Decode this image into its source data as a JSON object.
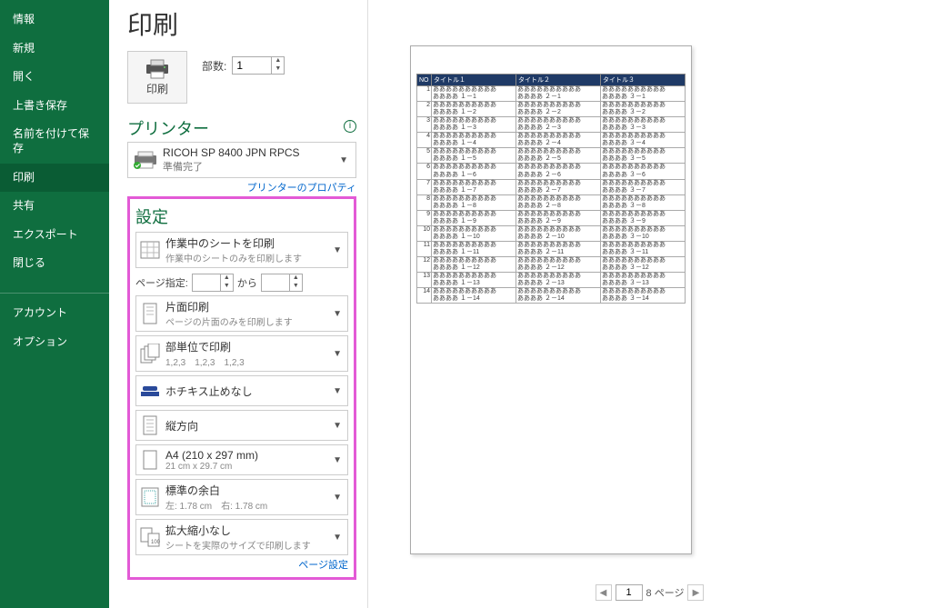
{
  "side": {
    "items": [
      "情報",
      "新規",
      "開く",
      "上書き保存",
      "名前を付けて保存",
      "印刷",
      "共有",
      "エクスポート",
      "閉じる"
    ],
    "lower": [
      "アカウント",
      "オプション"
    ],
    "activeIndex": 5
  },
  "title": "印刷",
  "printBtnLabel": "印刷",
  "copies": {
    "label": "部数:",
    "value": "1"
  },
  "printer": {
    "heading": "プリンター",
    "name": "RICOH SP 8400 JPN RPCS",
    "status": "準備完了",
    "propLink": "プリンターのプロパティ"
  },
  "settings": {
    "heading": "設定",
    "whatToPrint": {
      "line1": "作業中のシートを印刷",
      "line2": "作業中のシートのみを印刷します"
    },
    "pageRangeLabel": "ページ指定:",
    "pageRangeFrom": "",
    "pageRangeMid": "から",
    "pageRangeTo": "",
    "sides": {
      "line1": "片面印刷",
      "line2": "ページの片面のみを印刷します"
    },
    "collate": {
      "line1": "部単位で印刷",
      "line2": "1,2,3　1,2,3　1,2,3"
    },
    "staple": {
      "line1": "ホチキス止めなし"
    },
    "orient": {
      "line1": "縦方向"
    },
    "size": {
      "line1": "A4 (210 x 297 mm)",
      "line2": "21 cm x 29.7 cm"
    },
    "margins": {
      "line1": "標準の余白",
      "line2": "左: 1.78 cm　右: 1.78 cm"
    },
    "scale": {
      "line1": "拡大縮小なし",
      "line2": "シートを実際のサイズで印刷します"
    },
    "pageSetupLink": "ページ設定"
  },
  "preview": {
    "headers": [
      "NO",
      "タイトル１",
      "タイトル２",
      "タイトル３"
    ],
    "cell1": "ああああああああああ",
    "rowCount": 14,
    "col1p": "ああああ １－",
    "col2p": "ああああ ２－",
    "col3p": "ああああ ３－"
  },
  "pager": {
    "current": "1",
    "total": "8",
    "suffix": "ページ"
  }
}
